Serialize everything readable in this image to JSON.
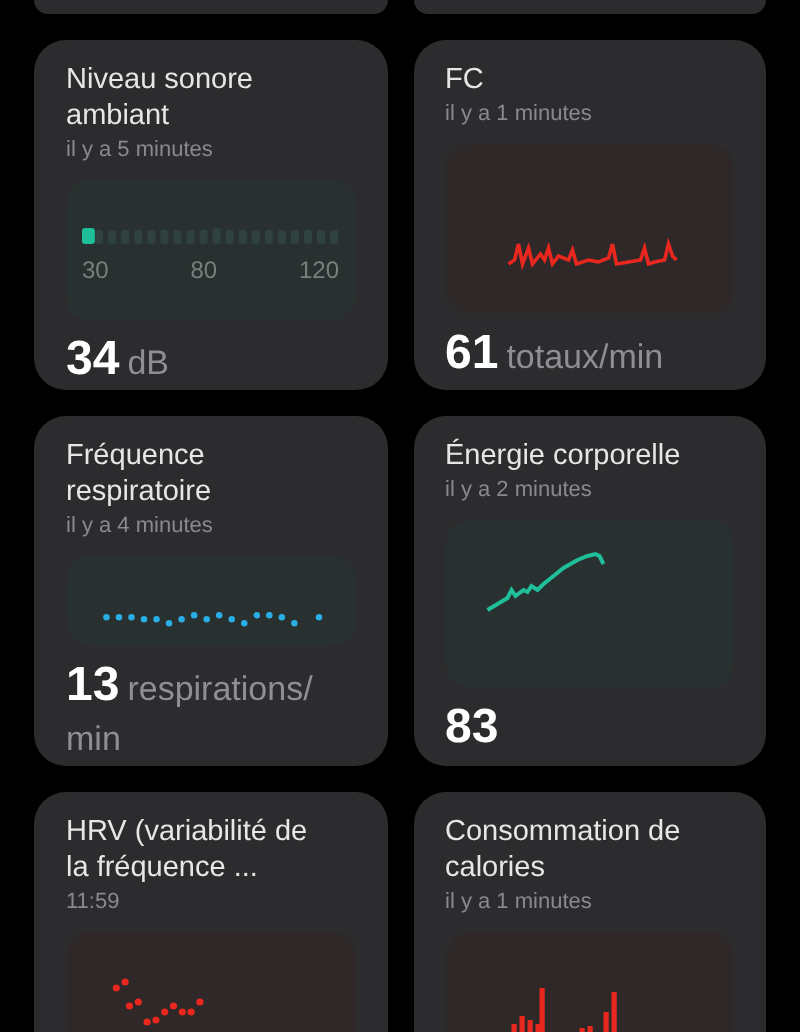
{
  "cards": [
    {
      "kind": "meter",
      "title": "Niveau sonore ambiant",
      "time": "il y a 5 minutes",
      "scale": [
        "30",
        "80",
        "120"
      ],
      "level": 0.05,
      "value": "34",
      "unit": "dB"
    },
    {
      "kind": "heart",
      "title": "FC",
      "time": "il y a 1 minutes",
      "value": "61",
      "unit": "totaux/min"
    },
    {
      "kind": "dots",
      "title": "Fréquence respiratoire",
      "time": "il y a 4 minutes",
      "value": "13",
      "unit": "respirations/ min"
    },
    {
      "kind": "trend",
      "title": "Énergie corporelle",
      "time": "il y a 2 minutes",
      "value": "83"
    },
    {
      "kind": "scatter",
      "title": "HRV (variabilité de la fréquence ...",
      "time": "11:59"
    },
    {
      "kind": "bars",
      "title": "Consommation de calories",
      "time": "il y a 1 minutes"
    }
  ]
}
